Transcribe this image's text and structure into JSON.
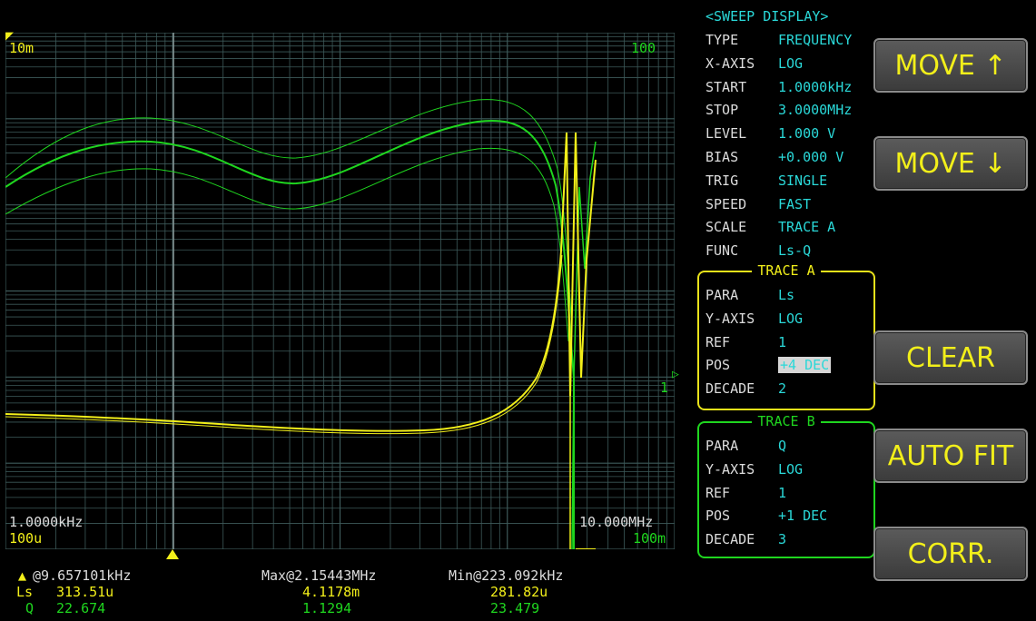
{
  "plot": {
    "y_top_left": "10m",
    "y_bottom_left": "100u",
    "y_top_right": "100",
    "y_bottom_right": "100m",
    "y_ref_right": "1",
    "x_start": "1.0000kHz",
    "x_stop": "10.000MHz"
  },
  "marker": {
    "label": "@9.657101kHz",
    "max_label": "Max@2.15443MHz",
    "min_label": "Min@223.092kHz",
    "ls": {
      "name": "Ls",
      "value": "313.51u",
      "max": "4.1178m",
      "min": "281.82u"
    },
    "q": {
      "name": "Q",
      "value": "22.674",
      "max": "1.1294",
      "min": "23.479"
    }
  },
  "panel": {
    "title": "<SWEEP DISPLAY>",
    "rows": [
      {
        "key": "TYPE",
        "value": "FREQUENCY"
      },
      {
        "key": "X-AXIS",
        "value": "LOG"
      },
      {
        "key": "START",
        "value": "1.0000kHz"
      },
      {
        "key": "STOP",
        "value": "3.0000MHz"
      },
      {
        "key": "LEVEL",
        "value": "1.000 V"
      },
      {
        "key": "BIAS",
        "value": "+0.000 V"
      },
      {
        "key": "TRIG",
        "value": "SINGLE"
      },
      {
        "key": "SPEED",
        "value": "FAST"
      },
      {
        "key": "SCALE",
        "value": "TRACE A"
      },
      {
        "key": "FUNC",
        "value": "Ls-Q"
      }
    ],
    "trace_a": {
      "title": "TRACE A",
      "rows": [
        {
          "key": "PARA",
          "value": "Ls"
        },
        {
          "key": "Y-AXIS",
          "value": "LOG"
        },
        {
          "key": "REF",
          "value": "1"
        },
        {
          "key": "POS",
          "value": "+4 DEC"
        },
        {
          "key": "DECADE",
          "value": "2"
        }
      ]
    },
    "trace_b": {
      "title": "TRACE B",
      "rows": [
        {
          "key": "PARA",
          "value": "Q"
        },
        {
          "key": "Y-AXIS",
          "value": "LOG"
        },
        {
          "key": "REF",
          "value": "1"
        },
        {
          "key": "POS",
          "value": "+1 DEC"
        },
        {
          "key": "DECADE",
          "value": "3"
        }
      ]
    }
  },
  "buttons": {
    "move_up": "MOVE ↑",
    "move_down": "MOVE ↓",
    "clear": "CLEAR",
    "auto_fit": "AUTO FIT",
    "corr": "CORR."
  },
  "colors": {
    "trace_a": "#f2ef1a",
    "trace_b": "#1fd61f",
    "value_text": "#2ad8d8",
    "grid": "#3d5a5a"
  }
}
